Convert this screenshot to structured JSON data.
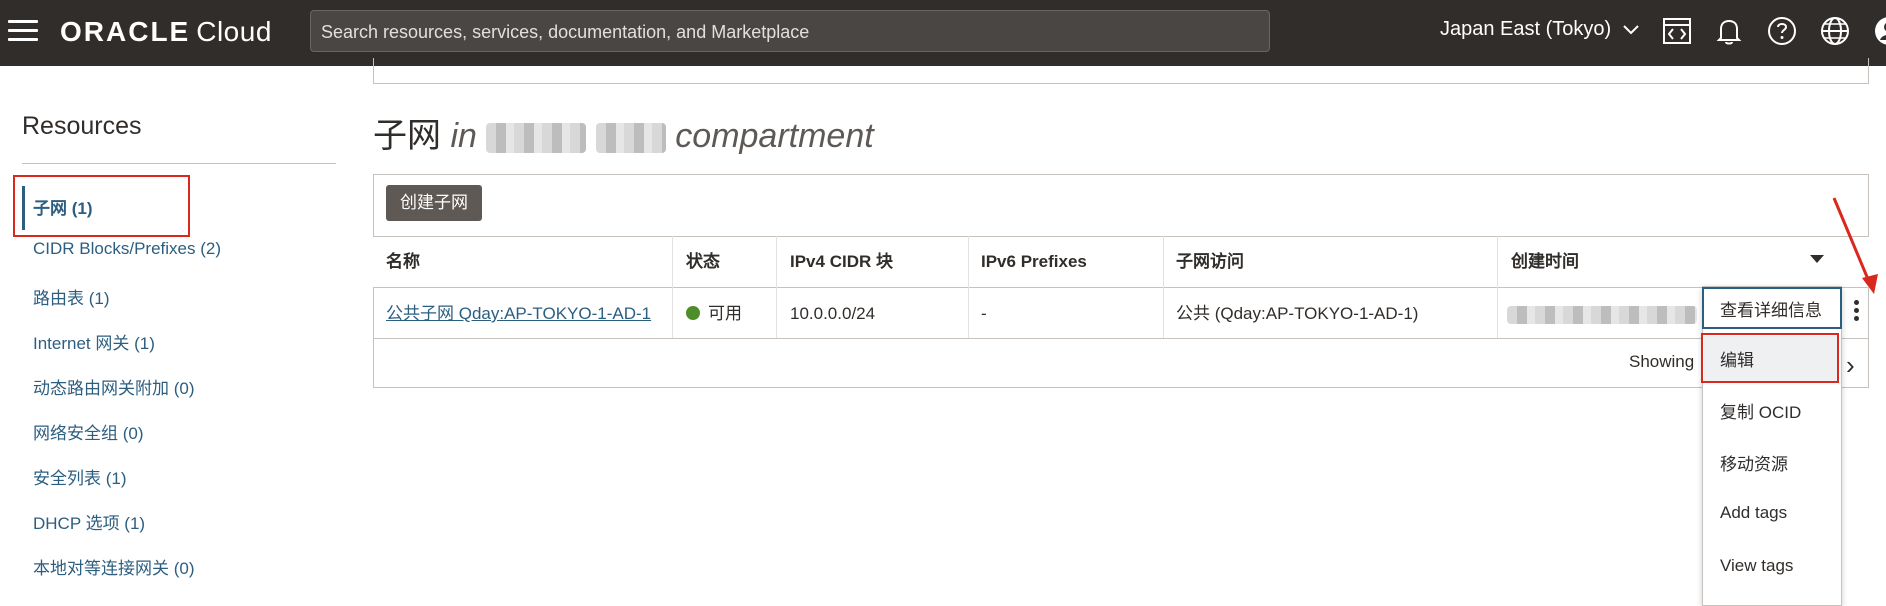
{
  "topbar": {
    "logo_oracle": "ORACLE",
    "logo_cloud": "Cloud",
    "search_placeholder": "Search resources, services, documentation, and Marketplace",
    "region": "Japan East (Tokyo)",
    "icons": [
      "menu-icon",
      "code-editor-icon",
      "bell-icon",
      "help-icon",
      "globe-icon",
      "avatar-icon"
    ]
  },
  "sidebar": {
    "title": "Resources",
    "items": [
      {
        "label": "子网 (1)",
        "active": true
      },
      {
        "label": "CIDR Blocks/Prefixes (2)"
      },
      {
        "label": "路由表 (1)"
      },
      {
        "label": "Internet 网关 (1)"
      },
      {
        "label": "动态路由网关附加 (0)"
      },
      {
        "label": "网络安全组 (0)"
      },
      {
        "label": "安全列表 (1)"
      },
      {
        "label": "DHCP 选项 (1)"
      },
      {
        "label": "本地对等连接网关 (0)"
      }
    ]
  },
  "main": {
    "title": "子网",
    "title_in": "in",
    "title_compartment": "compartment",
    "create_button": "创建子网",
    "table": {
      "columns": [
        "名称",
        "状态",
        "IPv4 CIDR 块",
        "IPv6 Prefixes",
        "子网访问",
        "创建时间"
      ],
      "rows": [
        {
          "name": "公共子网 Qday:AP-TOKYO-1-AD-1",
          "status": "可用",
          "ipv4": "10.0.0.0/24",
          "ipv6": "-",
          "access": "公共 (Qday:AP-TOKYO-1-AD-1)"
        }
      ]
    },
    "showing": "Showing"
  },
  "context_menu": {
    "items": [
      "查看详细信息",
      "编辑",
      "复制 OCID",
      "移动资源",
      "Add tags",
      "View tags"
    ]
  },
  "colors": {
    "topbar_bg": "#312d2a",
    "link": "#2c5e80",
    "highlight_red": "#d9281e",
    "status_green": "#4e8d2b"
  }
}
